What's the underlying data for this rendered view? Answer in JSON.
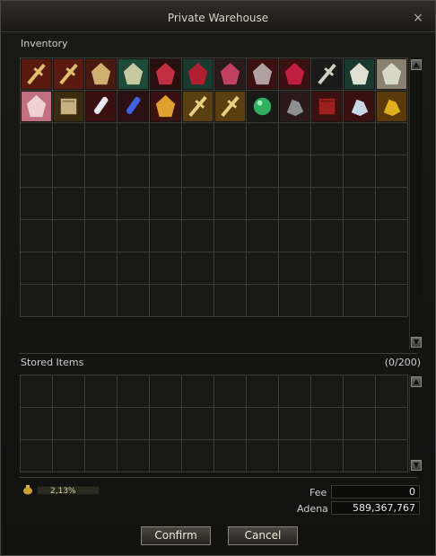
{
  "window": {
    "title": "Private Warehouse",
    "close_glyph": "×"
  },
  "inventory": {
    "label": "Inventory",
    "items": [
      "lance-icon",
      "lance-icon",
      "claw-icon",
      "fish-icon",
      "robe-icon",
      "chest-armor-icon",
      "tunic-icon",
      "shield-icon",
      "boots-icon",
      "dagger-icon",
      "crown-icon",
      "mask-icon",
      "claw-gauntlet-icon",
      "map-scroll-icon",
      "potion-white-icon",
      "potion-blue-icon",
      "amulet-icon",
      "bone-wand-icon",
      "bone-staff-icon",
      "green-orb-icon",
      "ore-icon",
      "spellbook-icon",
      "crystal-icon",
      "gold-ore-icon"
    ],
    "total_slots": 96
  },
  "stored": {
    "label": "Stored Items",
    "count": "(0/200)",
    "total_slots": 36
  },
  "weight": {
    "value": "2,13%"
  },
  "fee": {
    "label": "Fee",
    "value": "0"
  },
  "adena": {
    "label": "Adena",
    "value": "589,367,767"
  },
  "buttons": {
    "confirm": "Confirm",
    "cancel": "Cancel"
  },
  "scroll": {
    "up": "▲",
    "down": "▼"
  },
  "colors": {
    "slot_border": "#3b3b36",
    "accent": "#8a8070"
  }
}
